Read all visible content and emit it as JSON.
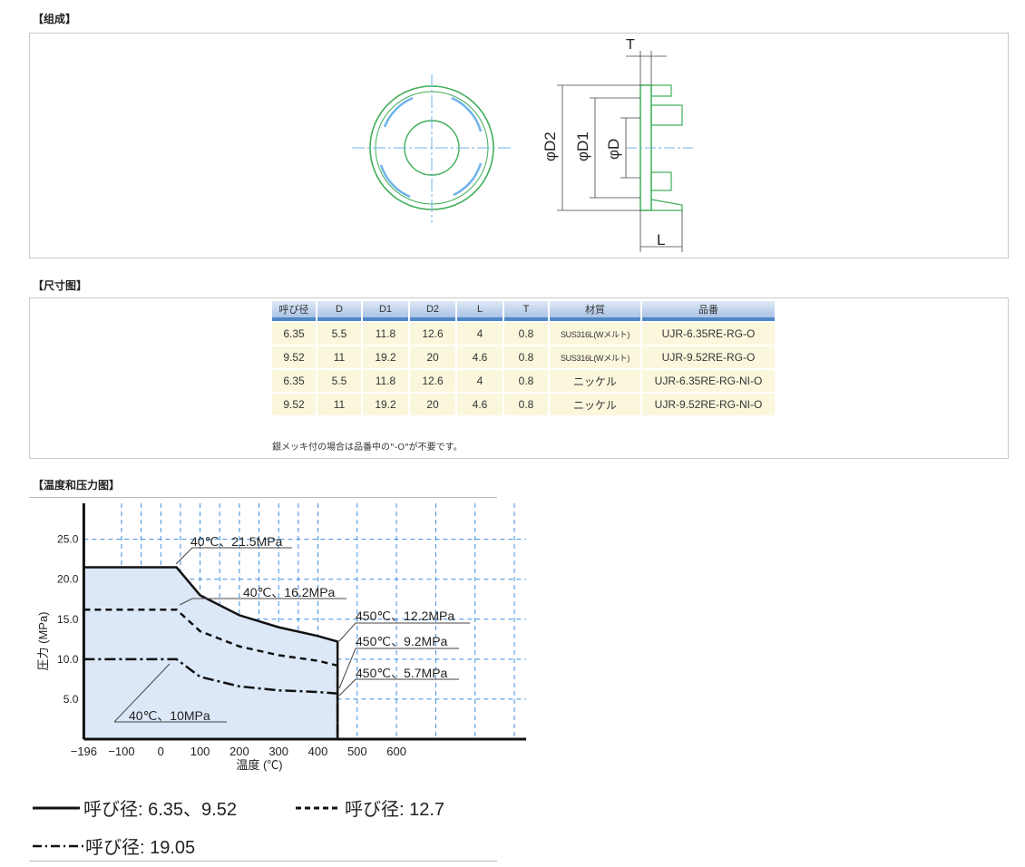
{
  "sections": {
    "compose_title": "【组成】",
    "dims_title": "【尺寸图】",
    "chart_title": "【温度和压力图】"
  },
  "drawing": {
    "label_t": "T",
    "label_d2": "φD2",
    "label_d1": "φD1",
    "label_d": "φD",
    "label_l": "L"
  },
  "table": {
    "headers": [
      "呼び径",
      "D",
      "D1",
      "D2",
      "L",
      "T",
      "材質",
      "品番"
    ],
    "rows": [
      [
        "6.35",
        "5.5",
        "11.8",
        "12.6",
        "4",
        "0.8",
        "SUS316L(Wメルト)",
        "UJR-6.35RE-RG-O"
      ],
      [
        "9.52",
        "11",
        "19.2",
        "20",
        "4.6",
        "0.8",
        "SUS316L(Wメルト)",
        "UJR-9.52RE-RG-O"
      ],
      [
        "6.35",
        "5.5",
        "11.8",
        "12.6",
        "4",
        "0.8",
        "ニッケル",
        "UJR-6.35RE-RG-NI-O"
      ],
      [
        "9.52",
        "11",
        "19.2",
        "20",
        "4.6",
        "0.8",
        "ニッケル",
        "UJR-9.52RE-RG-NI-O"
      ]
    ],
    "note": "銀メッキ付の場合は品番中の\"-O\"が不要です。"
  },
  "chart_data": {
    "type": "line",
    "xlabel": "温度 (℃)",
    "ylabel": "圧力 (MPa)",
    "x_tick_labels": [
      "−196",
      "−100",
      "0",
      "100",
      "200",
      "300",
      "400",
      "500",
      "600"
    ],
    "y_tick_labels": [
      "5.0",
      "10.0",
      "15.0",
      "20.0",
      "25.0"
    ],
    "x_ticks": [
      -196,
      -100,
      0,
      100,
      200,
      300,
      400,
      500,
      600
    ],
    "y_ticks": [
      5,
      10,
      15,
      20,
      25
    ],
    "xlim": [
      -220,
      930
    ],
    "ylim": [
      0,
      29.5
    ],
    "grid": true,
    "series": [
      {
        "name": "呼び径: 6.35、9.52",
        "style": "solid",
        "x": [
          -196,
          40,
          100,
          200,
          300,
          400,
          450
        ],
        "y": [
          21.5,
          21.5,
          18.0,
          15.5,
          14.0,
          12.9,
          12.2
        ]
      },
      {
        "name": "呼び径: 12.7",
        "style": "dashed",
        "x": [
          -196,
          40,
          100,
          200,
          300,
          400,
          450
        ],
        "y": [
          16.2,
          16.2,
          13.5,
          11.6,
          10.5,
          9.8,
          9.2
        ]
      },
      {
        "name": "呼び径: 19.05",
        "style": "dashdot",
        "x": [
          -196,
          40,
          100,
          200,
          300,
          400,
          450
        ],
        "y": [
          10,
          10,
          7.8,
          6.6,
          6.1,
          5.9,
          5.7
        ]
      }
    ],
    "annotations": [
      "40℃、21.5MPa",
      "40℃、16.2MPa",
      "40℃、10MPa",
      "450℃、12.2MPa",
      "450℃、9.2MPa",
      "450℃、5.7MPa"
    ]
  },
  "colors": {
    "drawing_green": "#3fae5a",
    "drawing_blue": "#6fb3ea",
    "table_header": "#a9c3e6",
    "table_cell": "#fbf7dd",
    "chart_fill": "#dce8f7",
    "grid": "#3c8fdc"
  }
}
